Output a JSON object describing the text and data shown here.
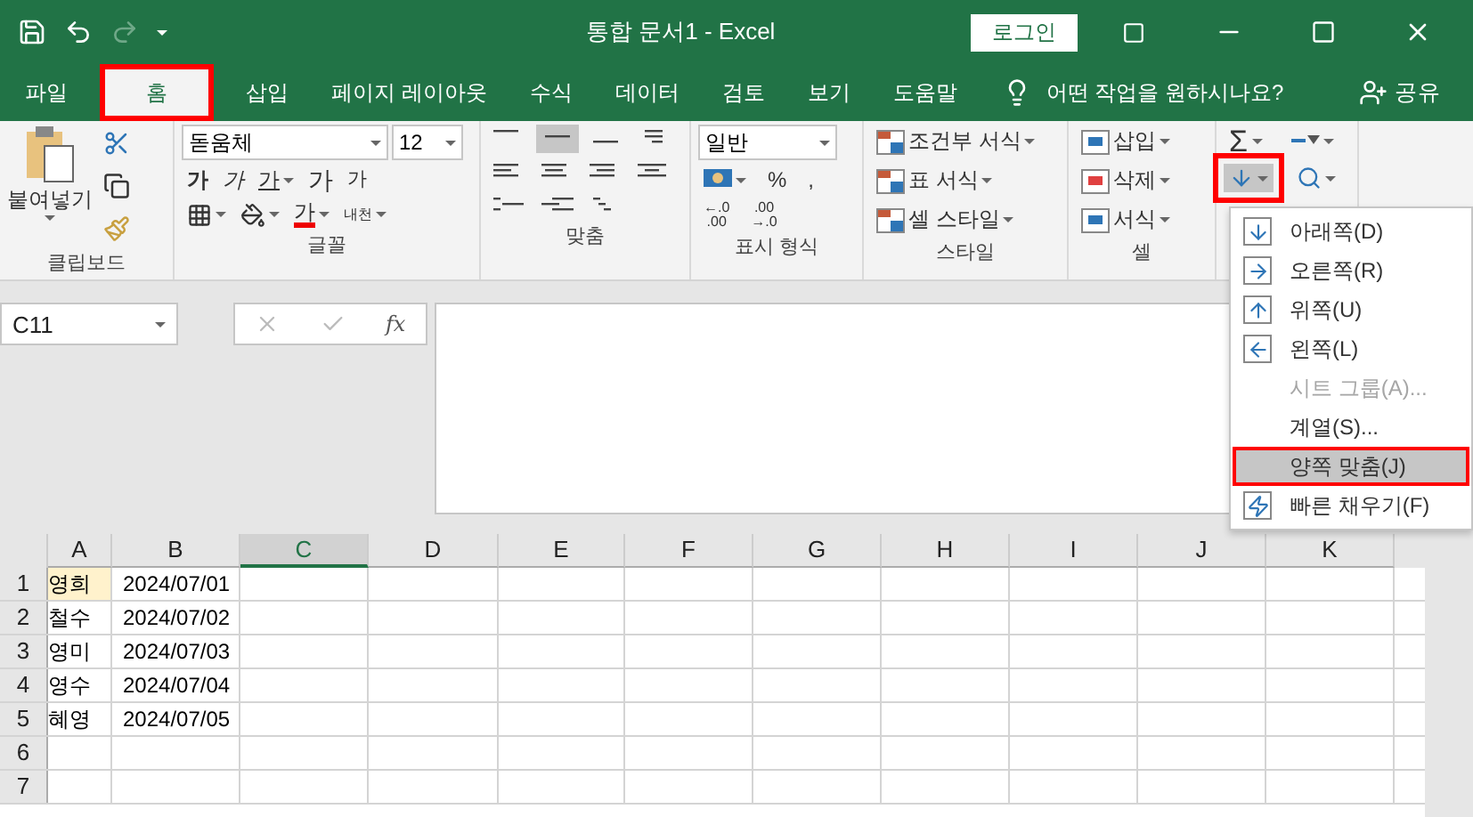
{
  "title_bar": {
    "title": "통합 문서1  -  Excel",
    "sign_in": "로그인"
  },
  "tabs": [
    {
      "label": "파일",
      "selected": false,
      "outlined": false
    },
    {
      "label": "홈",
      "selected": true,
      "outlined": true
    },
    {
      "label": "삽입",
      "selected": false,
      "outlined": false
    },
    {
      "label": "페이지 레이아웃",
      "selected": false,
      "outlined": false
    },
    {
      "label": "수식",
      "selected": false,
      "outlined": false
    },
    {
      "label": "데이터",
      "selected": false,
      "outlined": false
    },
    {
      "label": "검토",
      "selected": false,
      "outlined": false
    },
    {
      "label": "보기",
      "selected": false,
      "outlined": false
    },
    {
      "label": "도움말",
      "selected": false,
      "outlined": false
    }
  ],
  "tell_me": "어떤 작업을 원하시나요?",
  "share": "공유",
  "ribbon": {
    "clipboard": {
      "paste": "붙여넣기",
      "label": "클립보드"
    },
    "font": {
      "name": "돋움체",
      "size": "12",
      "bold": "가",
      "italic": "가",
      "underline": "가",
      "grow": "가",
      "shrink": "가",
      "font_color": "가",
      "phonetic": "내천",
      "label": "글꼴"
    },
    "alignment": {
      "label": "맞춤"
    },
    "number": {
      "format": "일반",
      "percent": "%",
      "comma": ",",
      "increase_decimal": [
        "←.0",
        ".00"
      ],
      "decrease_decimal": [
        ".00",
        "→.0"
      ],
      "label": "표시 형식"
    },
    "styles": {
      "items": [
        "조건부 서식",
        "표 서식",
        "셀 스타일"
      ],
      "label": "스타일"
    },
    "cells": {
      "items": [
        "삽입",
        "삭제",
        "서식"
      ],
      "label": "셀"
    },
    "editing": {
      "autosum": "Σ",
      "fill_outlined": true
    }
  },
  "formula_bar": {
    "name_box": "C11",
    "function": "fx"
  },
  "grid": {
    "columns": [
      {
        "label": "A",
        "selected": false
      },
      {
        "label": "B",
        "selected": false
      },
      {
        "label": "C",
        "selected": true
      },
      {
        "label": "D",
        "selected": false
      },
      {
        "label": "E",
        "selected": false
      },
      {
        "label": "F",
        "selected": false
      },
      {
        "label": "G",
        "selected": false
      },
      {
        "label": "H",
        "selected": false
      },
      {
        "label": "I",
        "selected": false
      },
      {
        "label": "J",
        "selected": false
      },
      {
        "label": "K",
        "selected": false
      }
    ],
    "rows": [
      {
        "label": "1",
        "cells": [
          {
            "text": "영희",
            "highlighted": true
          },
          {
            "text": "2024/07/01",
            "highlighted": false
          }
        ]
      },
      {
        "label": "2",
        "cells": [
          {
            "text": "철수",
            "highlighted": false
          },
          {
            "text": "2024/07/02",
            "highlighted": false
          }
        ]
      },
      {
        "label": "3",
        "cells": [
          {
            "text": "영미",
            "highlighted": false
          },
          {
            "text": "2024/07/03",
            "highlighted": false
          }
        ]
      },
      {
        "label": "4",
        "cells": [
          {
            "text": "영수",
            "highlighted": false
          },
          {
            "text": "2024/07/04",
            "highlighted": false
          }
        ]
      },
      {
        "label": "5",
        "cells": [
          {
            "text": "혜영",
            "highlighted": false
          },
          {
            "text": "2024/07/05",
            "highlighted": false
          }
        ]
      },
      {
        "label": "6",
        "cells": []
      },
      {
        "label": "7",
        "cells": []
      }
    ]
  },
  "fill_menu": {
    "items": [
      {
        "label": "아래쪽(D)",
        "disabled": false,
        "selected": false,
        "outlined": false
      },
      {
        "label": "오른쪽(R)",
        "disabled": false,
        "selected": false,
        "outlined": false
      },
      {
        "label": "위쪽(U)",
        "disabled": false,
        "selected": false,
        "outlined": false
      },
      {
        "label": "왼쪽(L)",
        "disabled": false,
        "selected": false,
        "outlined": false
      },
      {
        "label": "시트 그룹(A)...",
        "disabled": true,
        "selected": false,
        "outlined": false
      },
      {
        "label": "계열(S)...",
        "disabled": false,
        "selected": false,
        "outlined": false
      },
      {
        "label": "양쪽 맞춤(J)",
        "disabled": false,
        "selected": true,
        "outlined": true
      },
      {
        "label": "빠른 채우기(F)",
        "disabled": false,
        "selected": false,
        "outlined": false
      }
    ]
  }
}
